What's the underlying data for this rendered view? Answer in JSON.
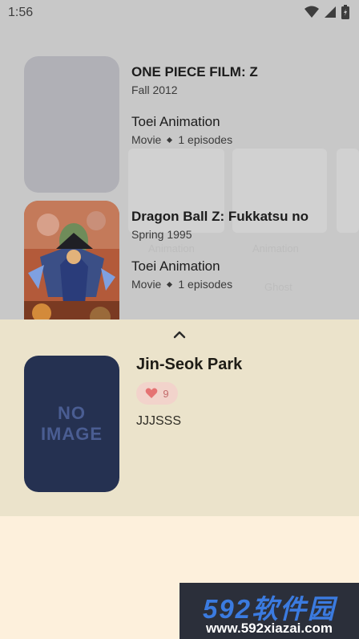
{
  "status_bar": {
    "time": "1:56",
    "icons": [
      "wifi-icon",
      "signal-icon",
      "battery-icon"
    ]
  },
  "list": {
    "items": [
      {
        "title": "ONE PIECE FILM: Z",
        "season": "Fall 2012",
        "studio": "Toei Animation",
        "format": "Movie",
        "episodes": "1 episodes"
      },
      {
        "title": "Dragon Ball Z: Fukkatsu no",
        "season": "Spring 1995",
        "studio": "Toei Animation",
        "format": "Movie",
        "episodes": "1 episodes"
      }
    ],
    "background_labels": [
      "Animation",
      "Animation",
      "Ghost"
    ]
  },
  "sheet": {
    "name": "Jin-Seok Park",
    "likes": "9",
    "subtitle": "JJJSSS",
    "no_image_line1": "NO",
    "no_image_line2": "IMAGE",
    "handle_icon": "chevron-up-icon"
  },
  "watermark": {
    "brand": "592软件园",
    "url": "www.592xiazai.com"
  },
  "colors": {
    "sheet_bg": "#ebe3cb",
    "page_bg": "#fdf0dc",
    "no_image_bg": "#253151",
    "like_chip": "#f2d3cb",
    "like_heart": "#e57373"
  }
}
